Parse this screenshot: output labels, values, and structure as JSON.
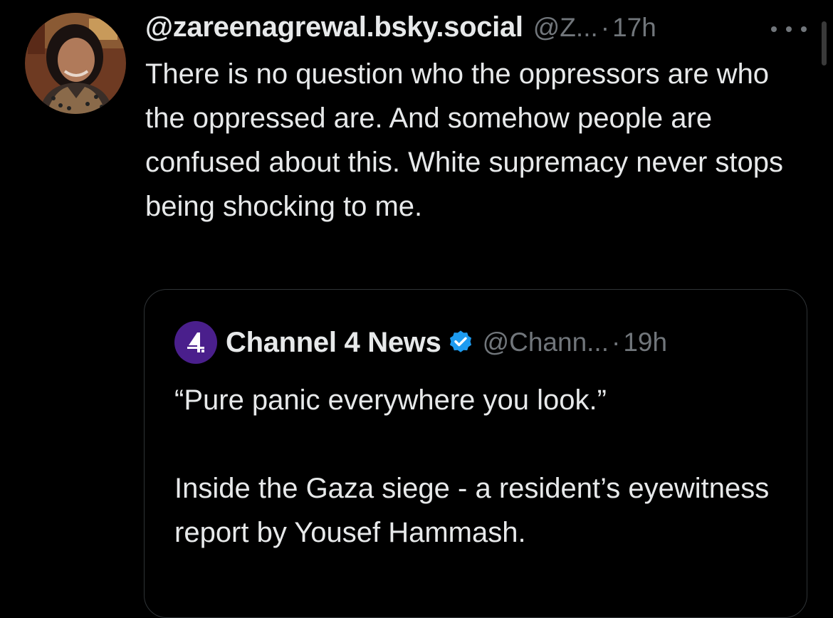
{
  "tweet": {
    "display_name": "@zareenagrewal.bsky.social",
    "handle": "@Z...",
    "separator": "·",
    "time": "17h",
    "avatar": "profile-photo",
    "text": "There is no question who the oppressors are who the oppressed are. And somehow people are confused about this. White supremacy never stops being shocking to me."
  },
  "quote": {
    "name": "Channel 4 News",
    "verified": true,
    "handle": "@Chann...",
    "separator": "·",
    "time": "19h",
    "logo": "channel-4-logo",
    "paragraphs": [
      "“Pure panic everywhere you look.”",
      "Inside the Gaza siege - a resident’s eyewitness report by Yousef Hammash."
    ]
  },
  "colors": {
    "background": "#000000",
    "text": "#e7e9ea",
    "muted": "#71767b",
    "border": "#2f3336",
    "verified": "#1d9bf0",
    "channel4": "#4a1f8c"
  },
  "icons": {
    "more": "more-horizontal-icon",
    "verified": "verified-badge-icon"
  }
}
